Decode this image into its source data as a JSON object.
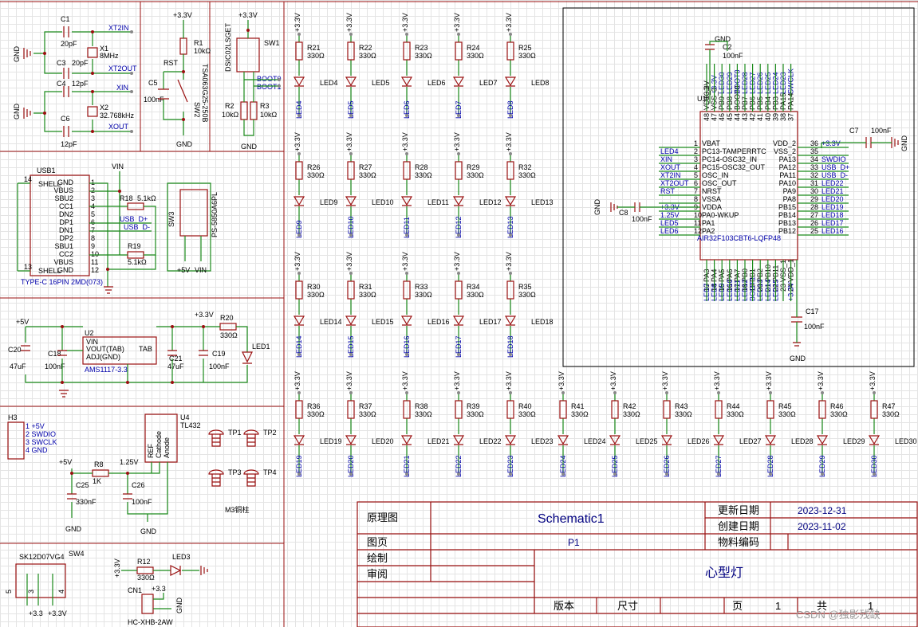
{
  "title_block": {
    "schematic_label": "原理图",
    "schematic_name": "Schematic1",
    "page_label": "图页",
    "page_value": "P1",
    "drawn_label": "绘制",
    "review_label": "审阅",
    "updated_label": "更新日期",
    "updated_value": "2023-12-31",
    "created_label": "创建日期",
    "created_value": "2023-11-02",
    "material_label": "物料编码",
    "project_title": "心型灯",
    "version_label": "版本",
    "size_label": "尺寸",
    "page_num_label": "页",
    "page_num": "1",
    "total_label": "共",
    "total_num": "1",
    "watermark": "CSDN @独影残缺"
  },
  "crystal": {
    "c1": "C1",
    "c1v": "20pF",
    "c3": "C3",
    "c3v": "20pF",
    "c4": "C4",
    "c4v": "12pF",
    "c6": "C6",
    "c6v": "12pF",
    "x1": "X1",
    "x1v": "8MHz",
    "x2": "X2",
    "x2v": "32.768kHz",
    "xt2in": "XT2IN",
    "xt2out": "XT2OUT",
    "xin": "XIN",
    "xout": "XOUT",
    "gnd": "GND"
  },
  "reset": {
    "vcc": "+3.3V",
    "r1": "R1",
    "r1v": "10kΩ",
    "rst": "RST",
    "c5": "C5",
    "c5v": "100nF",
    "sw2": "SW2",
    "sw2v": "TSA063G25-250B",
    "gnd": "GND"
  },
  "boot": {
    "vcc": "+3.3V",
    "sw1": "SW1",
    "sw1v": "DSIC02LSGET",
    "boot0": "BOOT0",
    "boot1": "BOOT1",
    "r2": "R2",
    "r2v": "10kΩ",
    "r3": "R3",
    "r3v": "10kΩ",
    "gnd": "GND"
  },
  "usb": {
    "ref": "USB1",
    "part": "TYPE-C 16PIN 2MD(073)",
    "vin": "VIN",
    "left_pins": [
      [
        "SHELL",
        "14"
      ],
      [
        "SHELL",
        "13"
      ]
    ],
    "right_pins": [
      [
        "GND",
        "1"
      ],
      [
        "VBUS",
        "2"
      ],
      [
        "SBU2",
        "3"
      ],
      [
        "CC1",
        "4"
      ],
      [
        "DN2",
        "5"
      ],
      [
        "DP1",
        "6"
      ],
      [
        "DN1",
        "7"
      ],
      [
        "DP2",
        "8"
      ],
      [
        "SBU1",
        "9"
      ],
      [
        "CC2",
        "10"
      ],
      [
        "VBUS",
        "11"
      ],
      [
        "GND",
        "12"
      ]
    ],
    "r18": "R18",
    "r18v": "5.1kΩ",
    "r19": "R19",
    "r19v": "5.1kΩ",
    "usb_dp": "USB_D+",
    "usb_dm": "USB_D-",
    "sw3": "SW3",
    "sw3v": "PS-5850A6PL",
    "p5v": "+5V",
    "pvin": "VIN"
  },
  "ldo": {
    "p5v": "+5V",
    "p33": "+3.3V",
    "u2": "U2",
    "u2v": "AMS1117-3.3",
    "vin": "VIN",
    "vout": "VOUT(TAB)",
    "adj": "ADJ(GND)",
    "tab": "TAB",
    "c20": "C20",
    "c20v": "47uF",
    "c18": "C18",
    "c18v": "100nF",
    "c21": "C21",
    "c21v": "47uF",
    "c19": "C19",
    "c19v": "100nF",
    "r20": "R20",
    "r20v": "330Ω",
    "led1": "LED1"
  },
  "h3": {
    "ref": "H3",
    "pins": [
      "1  +5V",
      "2  SWDIO",
      "3  SWCLK",
      "4  GND"
    ]
  },
  "tl432": {
    "u4": "U4",
    "u4v": "TL432",
    "p5v": "+5V",
    "r8": "R8",
    "r8v": "1K",
    "v125": "1.25V",
    "c25": "C25",
    "c25v": "330nF",
    "c26": "C26",
    "c26v": "100nF",
    "ref": "REF",
    "cathode": "Cathode",
    "anode": "Anode",
    "gnd": "GND"
  },
  "testpoints": {
    "tp1": "TP1",
    "tp2": "TP2",
    "tp3": "TP3",
    "tp4": "TP4",
    "note": "M3铜柱"
  },
  "sw4": {
    "ref": "SW4",
    "part": "SK12D07VG4",
    "p5": "5",
    "p3": "3",
    "p4": "4",
    "v1": "+3.3",
    "v2": "+3.3V",
    "r12": "R12",
    "r12v": "330Ω",
    "led3": "LED3",
    "p33": "+3.3V",
    "cn1": "CN1",
    "cn1v": "HC-XHB-2AW",
    "cn_v": "+3.3",
    "gnd": "GND"
  },
  "mcu": {
    "u1": "U1",
    "part": "AIR32F103CBT6-LQFP48",
    "c2": "C2",
    "c2v": "100nF",
    "c7": "C7",
    "c7v": "100nF",
    "c8": "C8",
    "c8v": "100nF",
    "c17": "C17",
    "c17v": "100nF",
    "gnd": "GND",
    "p33": "+3.3V",
    "v125": "1.25V",
    "top_nets": [
      "+3.3V",
      "LED30",
      "LED29",
      "BOOT0",
      "LED28",
      "LED27",
      "LED26",
      "LED25",
      "LED24",
      "LED23",
      "SWCLK"
    ],
    "top_pins": [
      "VDD_3",
      "VSS_3",
      "PB9",
      "PB8",
      "BOOT0",
      "PB7",
      "PB6",
      "PB5",
      "PB4",
      "PB3",
      "PA15",
      "PA14"
    ],
    "top_nums": [
      "48",
      "47",
      "46",
      "45",
      "44",
      "43",
      "42",
      "41",
      "40",
      "39",
      "38",
      "37"
    ],
    "left_pins": [
      "VBAT",
      "PC13-TAMPERRTC",
      "PC14-OSC32_IN",
      "PC15-OSC32_OUT",
      "OSC_IN",
      "OSC_OUT",
      "NRST",
      "VSSA",
      "VDDA",
      "PA0-WKUP",
      "PA1",
      "PA2"
    ],
    "left_nums": [
      "1",
      "2",
      "3",
      "4",
      "5",
      "6",
      "7",
      "8",
      "9",
      "10",
      "11",
      "12"
    ],
    "left_nets": [
      "",
      "LED4",
      "XIN",
      "XOUT",
      "XT2IN",
      "XT2OUT",
      "RST",
      "",
      "+3.3V",
      "1.25V",
      "LED5",
      "LED6"
    ],
    "right_pins": [
      "VDD_2",
      "VSS_2",
      "PA13",
      "PA12",
      "PA11",
      "PA10",
      "PA9",
      "PA8",
      "PB15",
      "PB14",
      "PB13",
      "PB12"
    ],
    "right_nums": [
      "36",
      "35",
      "34",
      "33",
      "32",
      "31",
      "30",
      "29",
      "28",
      "27",
      "26",
      "25"
    ],
    "right_nets": [
      "+3.3V",
      "",
      "SWDIO",
      "USB_D+",
      "USB_D-",
      "LED22",
      "LED21",
      "LED20",
      "LED19",
      "LED18",
      "LED17",
      "LED16"
    ],
    "bottom_pins": [
      "PA3",
      "PA4",
      "PA5",
      "PA6",
      "PA7",
      "PB0",
      "PB1",
      "PB2",
      "PB10",
      "PB11",
      "VSS_1",
      "VDD_1"
    ],
    "bottom_nums": [
      "13",
      "14",
      "15",
      "16",
      "17",
      "18",
      "19",
      "20",
      "21",
      "22",
      "23",
      "24"
    ],
    "bottom_nets": [
      "LED7",
      "LED8",
      "LED9",
      "LED10",
      "LED11",
      "LED12",
      "BOOT1",
      "LED13",
      "LED14",
      "LED15",
      "",
      "+3.3V"
    ]
  },
  "led_array": {
    "vcc": "+3.3V",
    "res_value": "330Ω",
    "rows": [
      [
        [
          "R21",
          "LED4"
        ],
        [
          "R22",
          "LED5"
        ],
        [
          "R23",
          "LED6"
        ],
        [
          "R24",
          "LED7"
        ],
        [
          "R25",
          "LED8"
        ]
      ],
      [
        [
          "R26",
          "LED9"
        ],
        [
          "R27",
          "LED10"
        ],
        [
          "R28",
          "LED11"
        ],
        [
          "R29",
          "LED12"
        ],
        [
          "R32",
          "LED13"
        ]
      ],
      [
        [
          "R30",
          "LED14"
        ],
        [
          "R31",
          "LED15"
        ],
        [
          "R33",
          "LED16"
        ],
        [
          "R34",
          "LED17"
        ],
        [
          "R35",
          "LED18"
        ]
      ],
      [
        [
          "R36",
          "LED19"
        ],
        [
          "R37",
          "LED20"
        ],
        [
          "R38",
          "LED21"
        ],
        [
          "R39",
          "LED22"
        ],
        [
          "R40",
          "LED23"
        ],
        [
          "R41",
          "LED24"
        ],
        [
          "R42",
          "LED25"
        ],
        [
          "R43",
          "LED26"
        ],
        [
          "R44",
          "LED27"
        ],
        [
          "R45",
          "LED28"
        ],
        [
          "R46",
          "LED29"
        ],
        [
          "R47",
          "LED30"
        ]
      ]
    ]
  }
}
